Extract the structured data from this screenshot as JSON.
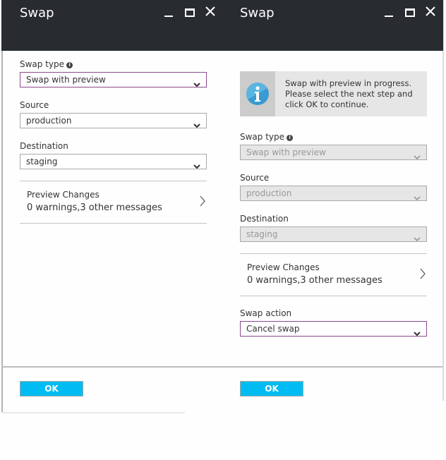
{
  "left_panel": {
    "title": "Swap",
    "window_controls": {
      "minimize": "minimize-icon",
      "maximize": "maximize-icon",
      "close": "close-icon"
    },
    "swap_type": {
      "label": "Swap type",
      "value": "Swap with preview",
      "state": "focused"
    },
    "source": {
      "label": "Source",
      "value": "production"
    },
    "destination": {
      "label": "Destination",
      "value": "staging"
    },
    "preview_changes": {
      "title": "Preview Changes",
      "summary": "0 warnings,3 other messages"
    },
    "ok_label": "OK"
  },
  "right_panel": {
    "title": "Swap",
    "window_controls": {
      "minimize": "minimize-icon",
      "maximize": "maximize-icon",
      "close": "close-icon"
    },
    "notice": {
      "icon": "info-icon",
      "message": "Swap with preview in progress. Please select the next step and click OK to continue."
    },
    "swap_type": {
      "label": "Swap type",
      "value": "Swap with preview",
      "state": "disabled"
    },
    "source": {
      "label": "Source",
      "value": "production",
      "state": "disabled"
    },
    "destination": {
      "label": "Destination",
      "value": "staging",
      "state": "disabled"
    },
    "preview_changes": {
      "title": "Preview Changes",
      "summary": "0 warnings,3 other messages"
    },
    "swap_action": {
      "label": "Swap action",
      "value": "Cancel swap"
    },
    "ok_label": "OK"
  },
  "colors": {
    "header_bg": "#282c31",
    "ok_button": "#00bcf2",
    "focus_border": "#8b4a8f",
    "info_icon": "#3a9ad1"
  }
}
